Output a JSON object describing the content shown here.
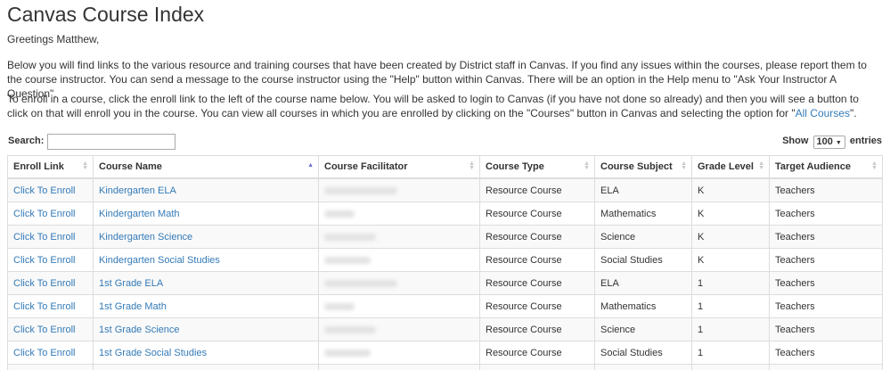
{
  "page": {
    "title": "Canvas Course Index",
    "greeting": "Greetings Matthew,",
    "para1": "Below you will find links to the various resource and training courses that have been created by District staff in Canvas. If you find any issues within the courses, please report them to the course instructor. You can send a message to the course instructor using the \"Help\" button within Canvas. There will be an option in the Help menu to \"Ask Your Instructor A Question\".",
    "para2_before": "To enroll in a course, click the enroll link to the left of the course name below. You will be asked to login to Canvas (if you have not done so already) and then you will see a button to click on that will enroll you in the course. You can view all courses in which you are enrolled by clicking on the \"Courses\" button in Canvas and selecting the option for \"",
    "para2_link": "All Courses",
    "para2_after": "\"."
  },
  "search": {
    "label": "Search:",
    "value": ""
  },
  "length": {
    "show": "Show",
    "value": "100",
    "entries": "entries"
  },
  "table": {
    "headers": [
      "Enroll Link",
      "Course Name",
      "Course Facilitator",
      "Course Type",
      "Course Subject",
      "Grade Level",
      "Target Audience"
    ],
    "rows": [
      [
        "Click To Enroll",
        "Kindergarten ELA",
        "",
        "Resource Course",
        "ELA",
        "K",
        "Teachers"
      ],
      [
        "Click To Enroll",
        "Kindergarten Math",
        "",
        "Resource Course",
        "Mathematics",
        "K",
        "Teachers"
      ],
      [
        "Click To Enroll",
        "Kindergarten Science",
        "",
        "Resource Course",
        "Science",
        "K",
        "Teachers"
      ],
      [
        "Click To Enroll",
        "Kindergarten Social Studies",
        "",
        "Resource Course",
        "Social Studies",
        "K",
        "Teachers"
      ],
      [
        "Click To Enroll",
        "1st Grade ELA",
        "",
        "Resource Course",
        "ELA",
        "1",
        "Teachers"
      ],
      [
        "Click To Enroll",
        "1st Grade Math",
        "",
        "Resource Course",
        "Mathematics",
        "1",
        "Teachers"
      ],
      [
        "Click To Enroll",
        "1st Grade Science",
        "",
        "Resource Course",
        "Science",
        "1",
        "Teachers"
      ],
      [
        "Click To Enroll",
        "1st Grade Social Studies",
        "",
        "Resource Course",
        "Social Studies",
        "1",
        "Teachers"
      ],
      [
        "",
        "",
        "",
        "",
        "",
        "",
        ""
      ]
    ]
  }
}
